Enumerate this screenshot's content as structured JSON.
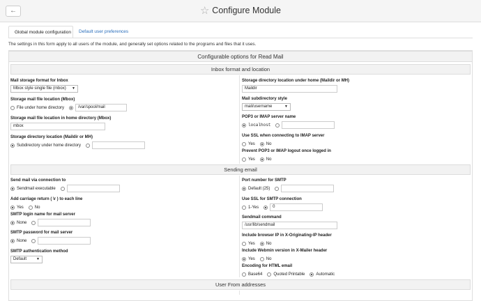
{
  "header": {
    "title": "Configure Module",
    "back_icon": "arrow-left-icon",
    "star_icon": "star-outline-icon"
  },
  "tabs": [
    {
      "label": "Global module configuration",
      "active": true
    },
    {
      "label": "Default user preferences",
      "active": false
    }
  ],
  "description": "The settings in this form apply to all users of the module, and generally set options related to the programs and files that it uses.",
  "form_title": "Configurable options for Read Mail",
  "sections": {
    "inbox": {
      "title": "Inbox format and location",
      "mail_storage_format": {
        "label": "Mail storage format for Inbox",
        "value": "Mbox style single file (mbox)"
      },
      "storage_file_location": {
        "label": "Storage mail file location (Mbox)",
        "opt1": "File under home directory",
        "value": "/var/spool/mail"
      },
      "storage_file_in_home": {
        "label": "Storage mail file location in home directory (Mbox)",
        "value": "mbox"
      },
      "storage_dir_location": {
        "label": "Storage directory location (Maildir or MH)",
        "opt1": "Subdirectory under home directory",
        "value": ""
      },
      "storage_dir_under_home": {
        "label": "Storage directory location under home (Maildir or MH)",
        "value": "Maildir"
      },
      "mail_subdir_style": {
        "label": "Mail subdirectory style",
        "value": "mail/username"
      },
      "pop3_server": {
        "label": "POP3 or IMAP server name",
        "value": "localhost"
      },
      "use_ssl_imap": {
        "label": "Use SSL when connecting to IMAP server",
        "yes": "Yes",
        "no": "No",
        "selected": "No"
      },
      "prevent_logout": {
        "label": "Prevent POP3 or IMAP logout once logged in",
        "yes": "Yes",
        "no": "No",
        "selected": "No"
      }
    },
    "sending": {
      "title": "Sending email",
      "send_via": {
        "label": "Send mail via connection to",
        "opt1": "Sendmail executable",
        "value": ""
      },
      "add_cr": {
        "label": "Add carriage return ( \\r ) to each line",
        "yes": "Yes",
        "no": "No",
        "selected": "Yes"
      },
      "smtp_login": {
        "label": "SMTP login name for mail server",
        "opt1": "None",
        "value": ""
      },
      "smtp_password": {
        "label": "SMTP password for mail server",
        "opt1": "None",
        "value": ""
      },
      "smtp_auth": {
        "label": "SMTP authentication method",
        "value": "Default"
      },
      "smtp_port": {
        "label": "Port number for SMTP",
        "opt1": "Default (25)",
        "value": ""
      },
      "use_ssl_smtp": {
        "label": "Use SSL for SMTP connection",
        "opt1": "1-Yes",
        "value": "0"
      },
      "sendmail_cmd": {
        "label": "Sendmail command",
        "value": "/usr/lib/sendmail"
      },
      "browser_ip": {
        "label": "Include browser IP in X-Originating-IP header",
        "yes": "Yes",
        "no": "No",
        "selected": "No"
      },
      "webmin_version": {
        "label": "Include Webmin version in X-Mailer header",
        "yes": "Yes",
        "no": "No",
        "selected": "Yes"
      },
      "html_encoding": {
        "label": "Encoding for HTML email",
        "opt1": "Base64",
        "opt2": "Quoted Printable",
        "opt3": "Automatic",
        "selected": "Automatic"
      }
    },
    "user_from": {
      "title": "User From addresses"
    }
  }
}
